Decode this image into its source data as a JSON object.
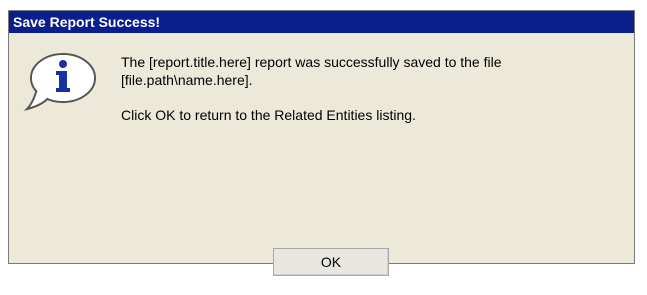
{
  "dialog": {
    "title": "Save Report Success!",
    "message_line_1": "The [report.title.here] report was successfully saved to the file [file.path\\name.here].",
    "message_line_2": "Click OK to return to the Related Entities listing.",
    "ok_label": "OK",
    "icon": "info-speech-bubble-icon"
  }
}
